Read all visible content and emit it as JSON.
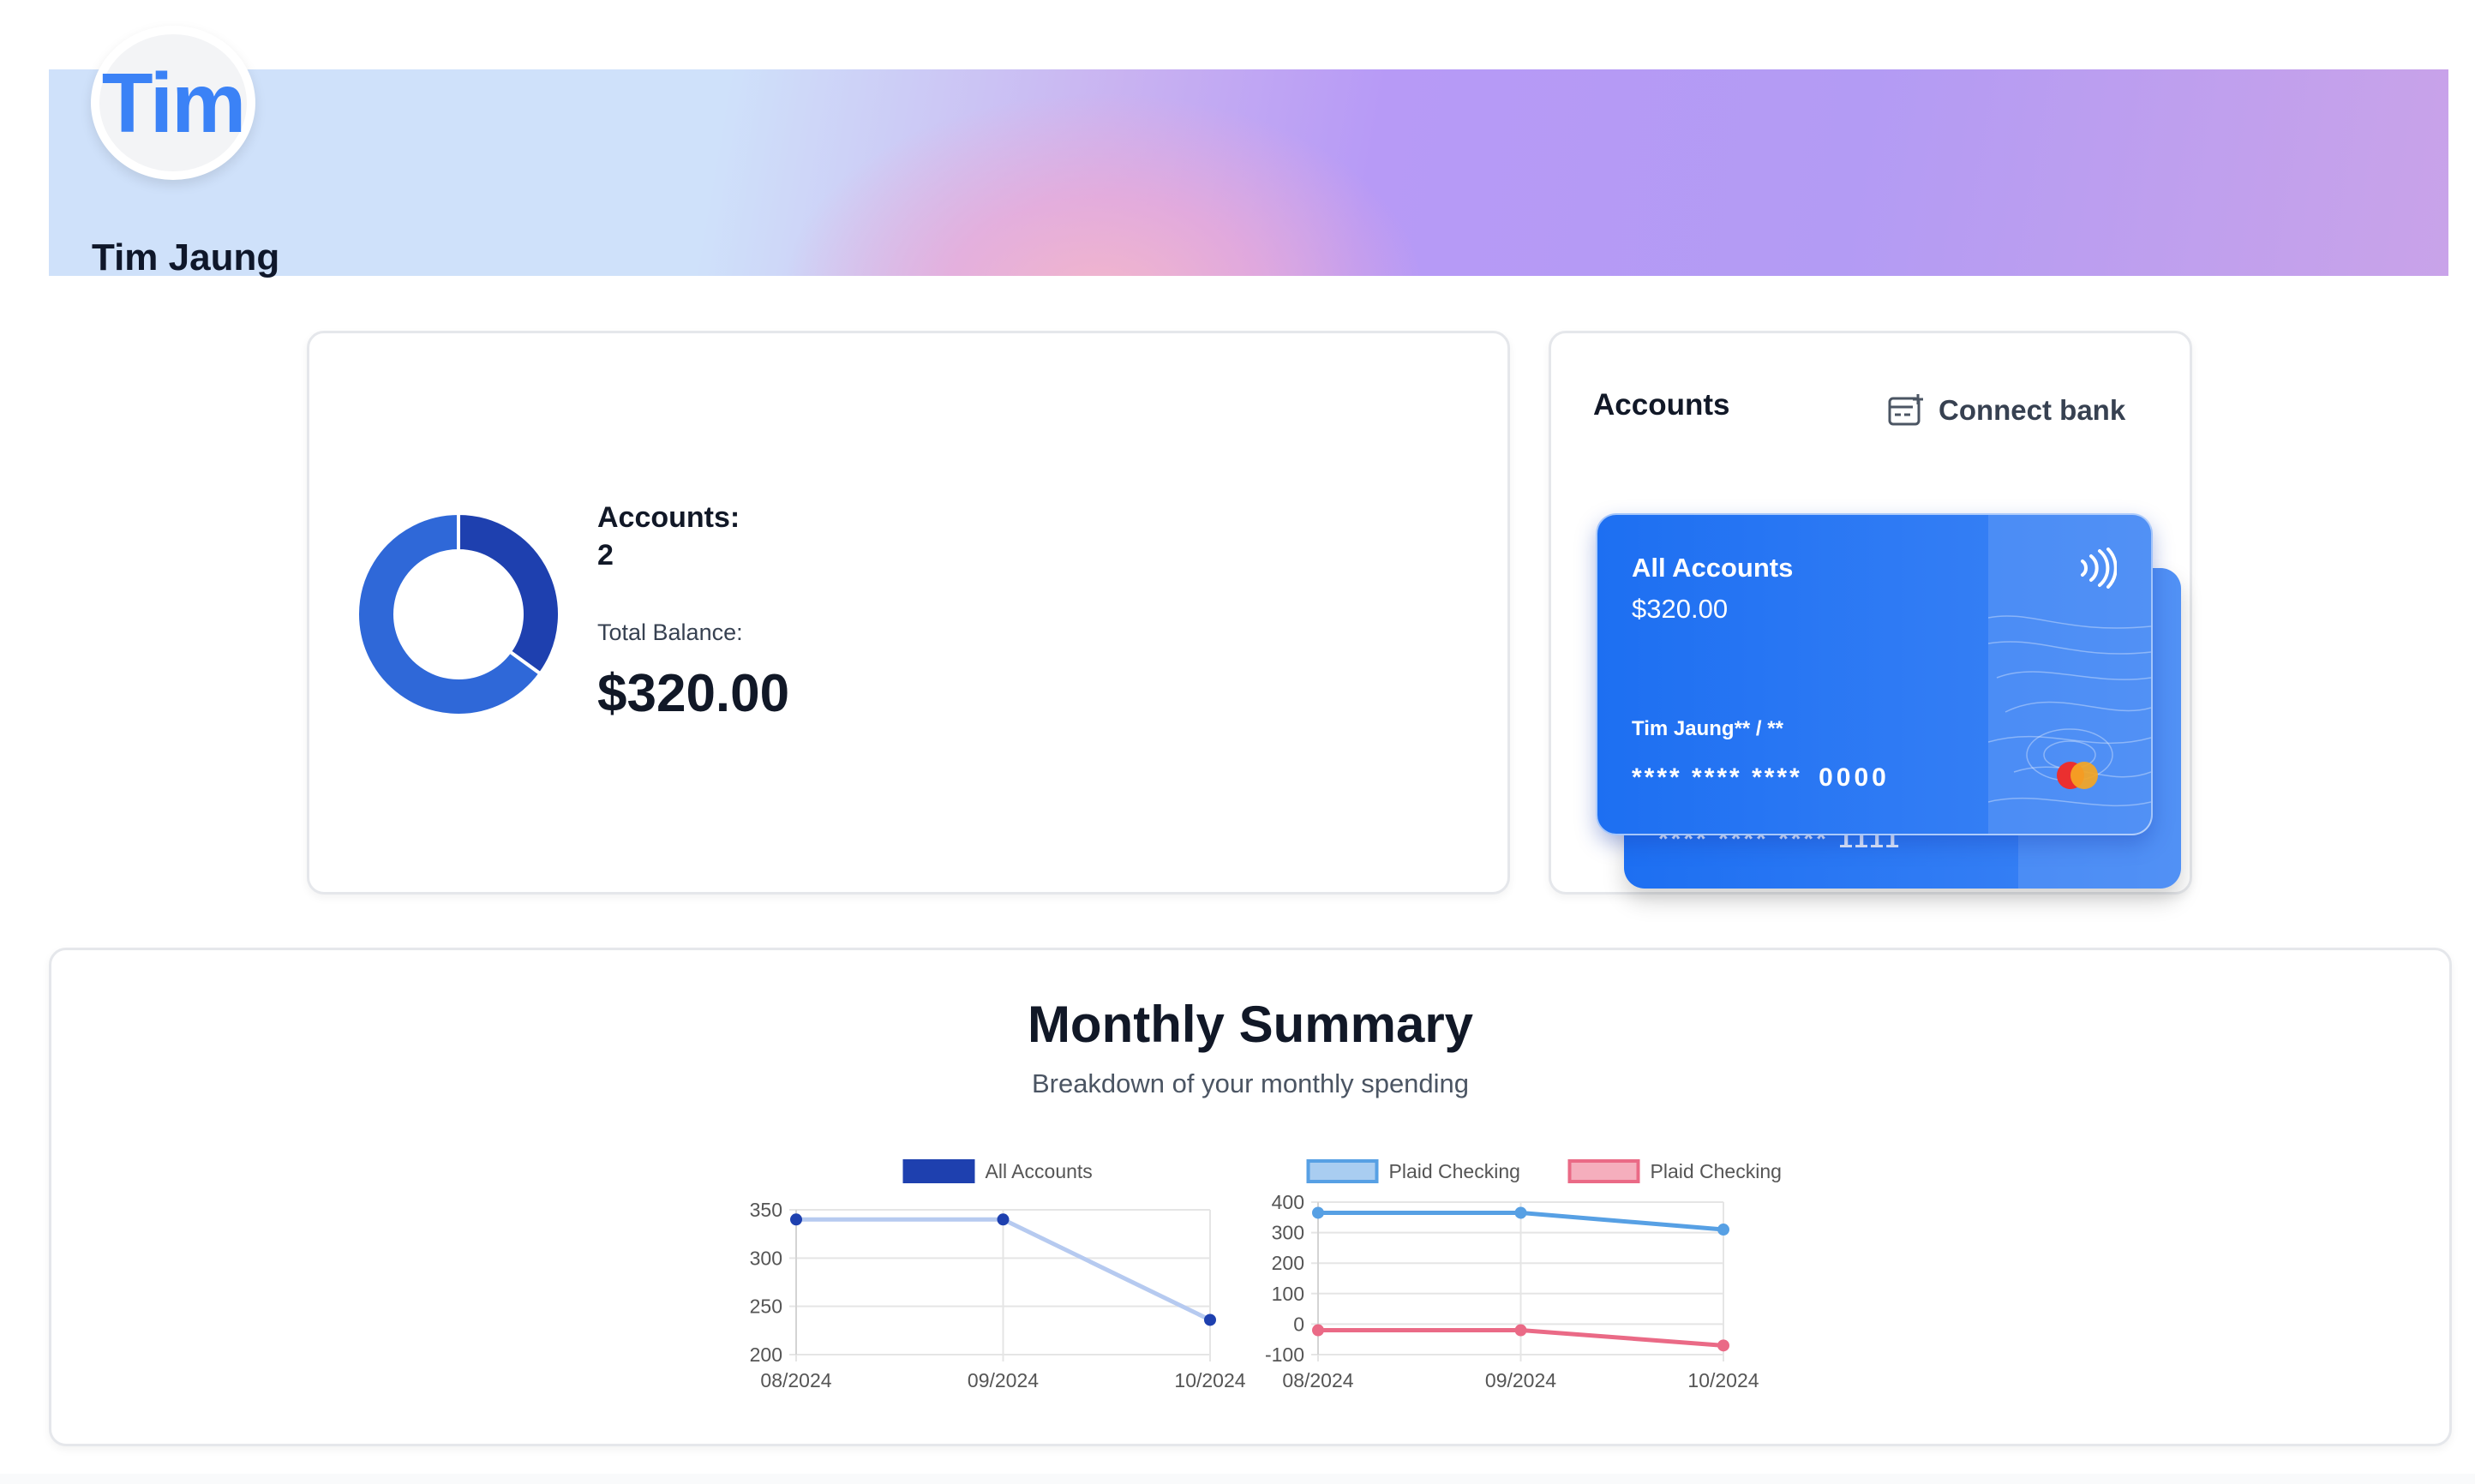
{
  "profile": {
    "avatar_text": "Tim",
    "name": "Tim Jaung"
  },
  "balance": {
    "accounts_label": "Accounts:",
    "accounts_count": "2",
    "total_balance_label": "Total Balance:",
    "total_balance": "$320.00",
    "donut": {
      "segments": [
        {
          "value": 35,
          "color": "#1e40af"
        },
        {
          "value": 65,
          "color": "#2f68d8"
        }
      ]
    }
  },
  "accounts": {
    "title": "Accounts",
    "connect_bank_label": "Connect bank",
    "card": {
      "name": "All Accounts",
      "balance": "$320.00",
      "holder": "Tim Jaung** / **",
      "masked": "**** **** ****",
      "last4": "0000"
    },
    "back_card": {
      "masked": "**** **** ****",
      "last4": "1111"
    }
  },
  "summary": {
    "title": "Monthly Summary",
    "subtitle": "Breakdown of your monthly spending"
  },
  "chart_data": [
    {
      "type": "line",
      "x": [
        "08/2024",
        "09/2024",
        "10/2024"
      ],
      "series": [
        {
          "name": "All Accounts",
          "values": [
            340,
            340,
            236
          ],
          "color": "#b6caf0",
          "point_color": "#1e40af"
        }
      ],
      "legend_color": "#1e40af",
      "ylim": [
        200,
        350
      ],
      "yticks": [
        200,
        250,
        300,
        350
      ],
      "grid": true,
      "legend": "top"
    },
    {
      "type": "line",
      "x": [
        "08/2024",
        "09/2024",
        "10/2024"
      ],
      "series": [
        {
          "name": "Plaid Checking",
          "values": [
            365,
            365,
            310
          ],
          "color": "#57a0e4",
          "point_color": "#57a0e4",
          "legend_fill": "#a9cdf1"
        },
        {
          "name": "Plaid Checking",
          "values": [
            -20,
            -20,
            -70
          ],
          "color": "#ea6a86",
          "point_color": "#ea6a86",
          "legend_fill": "#f5aebd"
        }
      ],
      "ylim": [
        -100,
        400
      ],
      "yticks": [
        -100,
        0,
        100,
        200,
        300,
        400
      ],
      "grid": true,
      "legend": "top"
    }
  ]
}
